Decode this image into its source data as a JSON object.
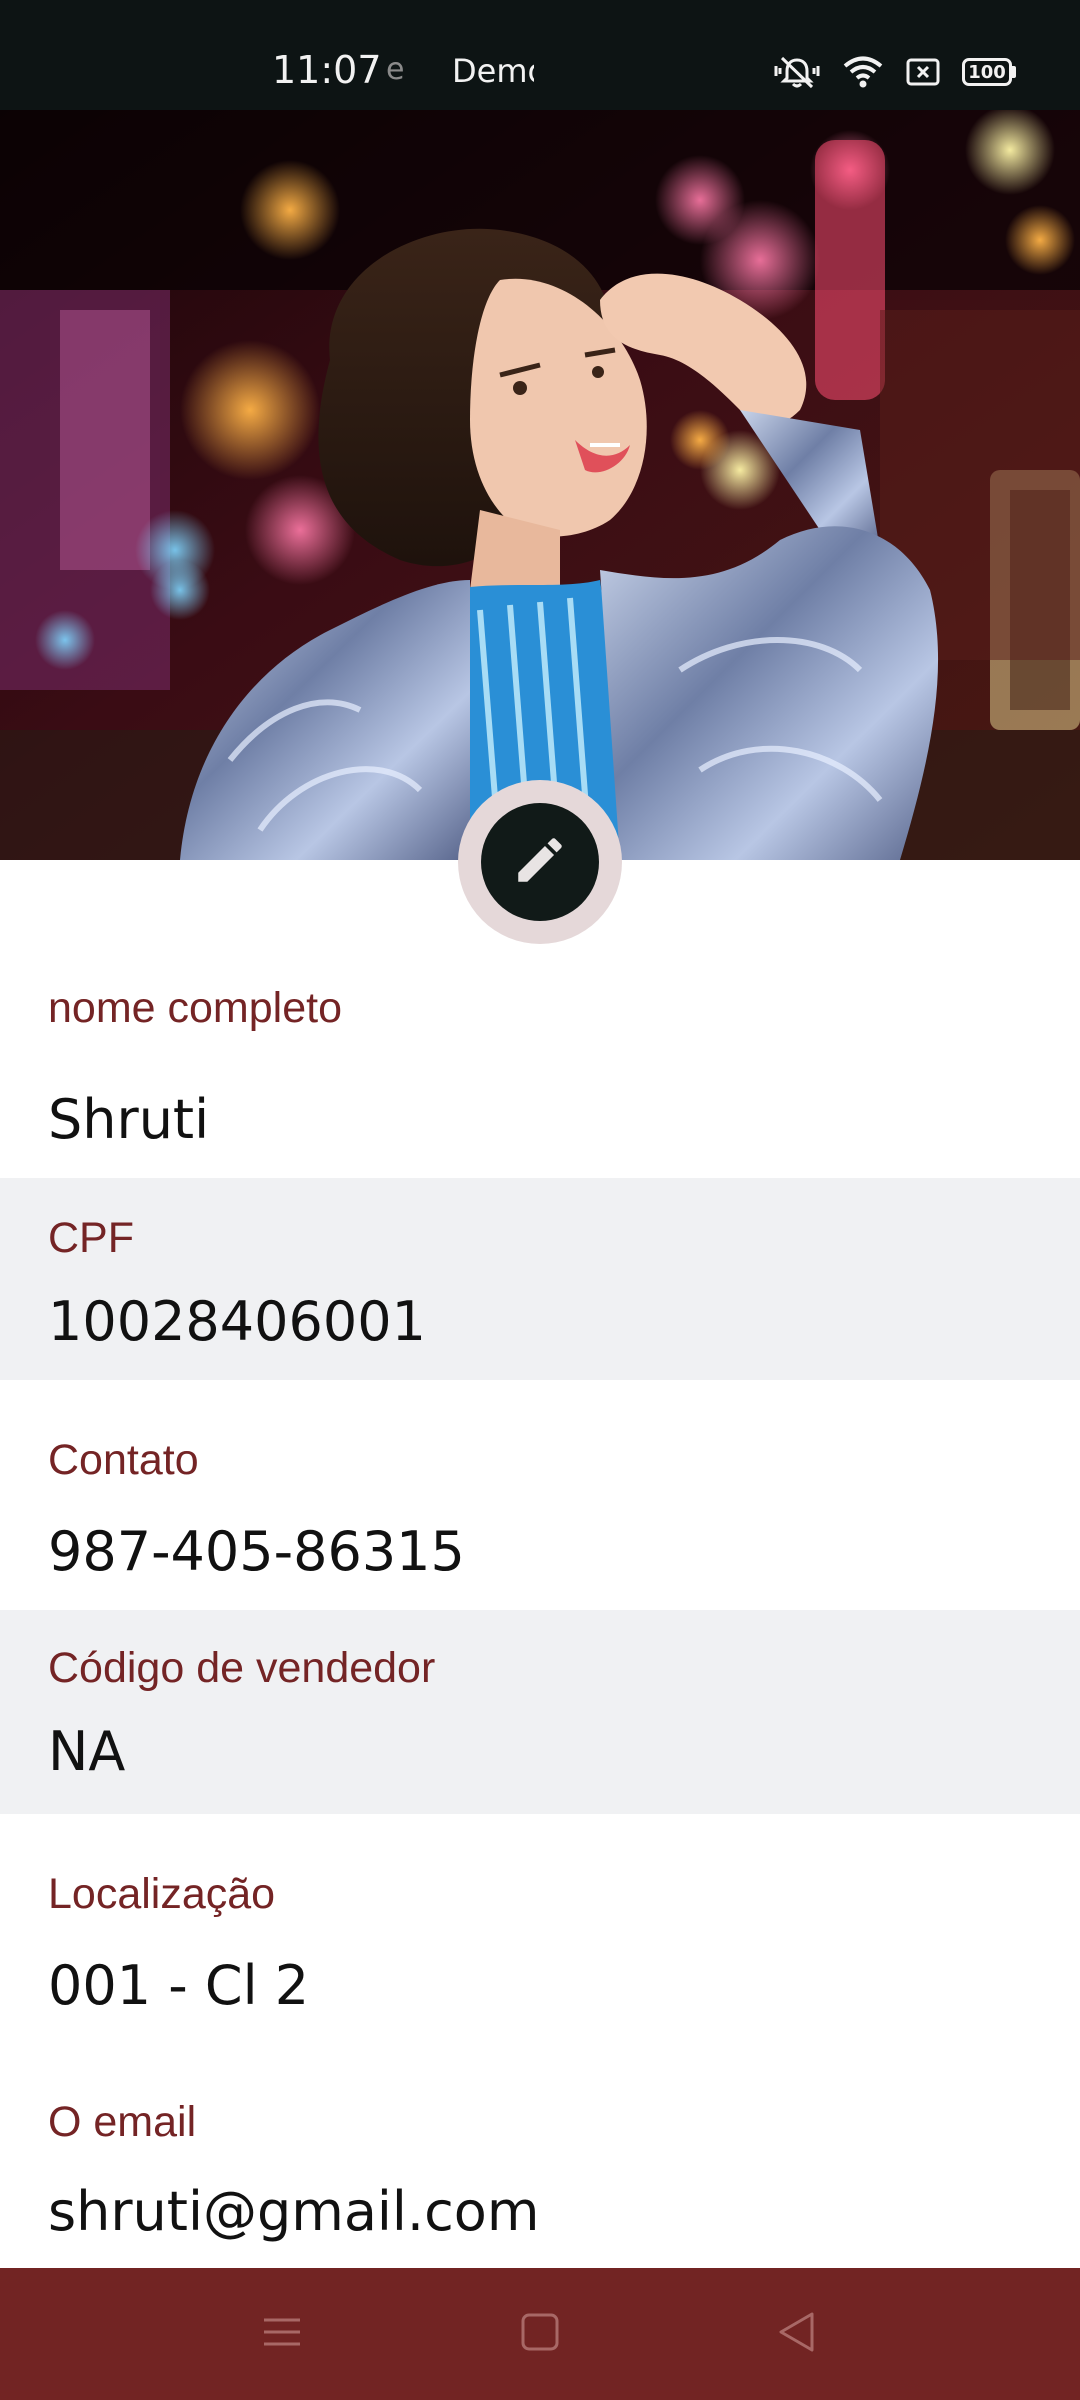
{
  "status_bar": {
    "time": "11:07",
    "notification_fragment": "e",
    "app_name_fragment": "Demo",
    "battery_level": "100",
    "icons": [
      "mute-vibrate-icon",
      "wifi-icon",
      "sim-card-icon",
      "battery-icon"
    ]
  },
  "profile": {
    "cover_photo": "profile-cover-photo",
    "edit_icon": "pencil-icon"
  },
  "fields": [
    {
      "label": "nome completo",
      "value": "Shruti"
    },
    {
      "label": "CPF",
      "value": "10028406001"
    },
    {
      "label": "Contato",
      "value": "987-405-86315"
    },
    {
      "label": "Código de vendedor",
      "value": "NA"
    },
    {
      "label": "Localização",
      "value": "001 - Cl 2"
    },
    {
      "label": "O email",
      "value": "shruti@gmail.com"
    }
  ],
  "nav_bar": {
    "icons": [
      "menu-icon",
      "home-square-icon",
      "back-triangle-icon"
    ]
  },
  "colors": {
    "label": "#742425",
    "nav_bar": "#722423",
    "alt_row": "#f0f1f3",
    "status_bar": "#0d1414"
  }
}
